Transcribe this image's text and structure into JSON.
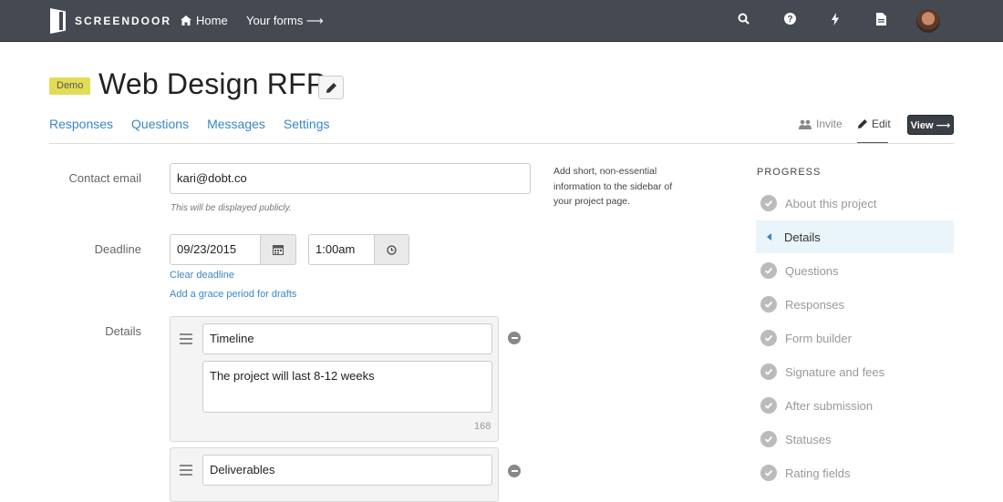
{
  "app": {
    "logo_text": "SCREENDOOR"
  },
  "nav": {
    "home": "Home",
    "your_forms": "Your forms"
  },
  "header": {
    "badge": "Demo",
    "title": "Web Design RFP"
  },
  "tabs": [
    "Responses",
    "Questions",
    "Messages",
    "Settings"
  ],
  "actions": {
    "invite": "Invite",
    "edit": "Edit",
    "view": "View"
  },
  "form": {
    "contact_email_label": "Contact email",
    "contact_email_value": "kari@dobt.co",
    "contact_email_hint": "This will be displayed publicly.",
    "deadline_label": "Deadline",
    "deadline_date": "09/23/2015",
    "deadline_time": "1:00am",
    "clear_deadline": "Clear deadline",
    "grace_period": "Add a grace period for drafts",
    "details_label": "Details",
    "side_note": "Add short, non-essential information to the sidebar of your project page.",
    "details": [
      {
        "title": "Timeline",
        "body": "The project will last 8-12 weeks",
        "count": "168"
      },
      {
        "title": "Deliverables",
        "body": "",
        "count": ""
      }
    ]
  },
  "progress": {
    "title": "PROGRESS",
    "items": [
      {
        "label": "About this project",
        "state": "done"
      },
      {
        "label": "Details",
        "state": "active"
      },
      {
        "label": "Questions",
        "state": "done"
      },
      {
        "label": "Responses",
        "state": "done"
      },
      {
        "label": "Form builder",
        "state": "done"
      },
      {
        "label": "Signature and fees",
        "state": "done"
      },
      {
        "label": "After submission",
        "state": "done"
      },
      {
        "label": "Statuses",
        "state": "done"
      },
      {
        "label": "Rating fields",
        "state": "done"
      }
    ]
  }
}
